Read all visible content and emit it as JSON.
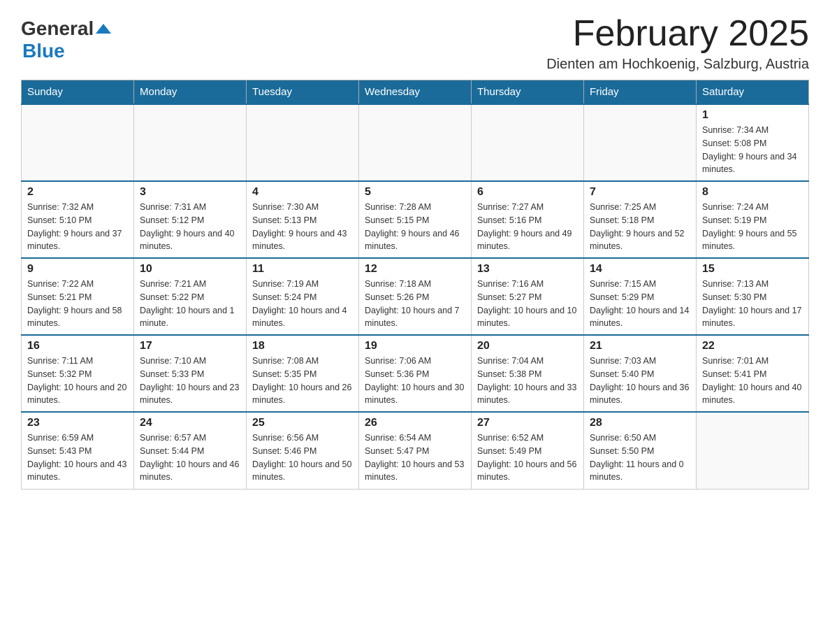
{
  "header": {
    "logo_general": "General",
    "logo_blue": "Blue",
    "month_title": "February 2025",
    "subtitle": "Dienten am Hochkoenig, Salzburg, Austria"
  },
  "weekdays": [
    "Sunday",
    "Monday",
    "Tuesday",
    "Wednesday",
    "Thursday",
    "Friday",
    "Saturday"
  ],
  "weeks": [
    [
      {
        "day": "",
        "sunrise": "",
        "sunset": "",
        "daylight": ""
      },
      {
        "day": "",
        "sunrise": "",
        "sunset": "",
        "daylight": ""
      },
      {
        "day": "",
        "sunrise": "",
        "sunset": "",
        "daylight": ""
      },
      {
        "day": "",
        "sunrise": "",
        "sunset": "",
        "daylight": ""
      },
      {
        "day": "",
        "sunrise": "",
        "sunset": "",
        "daylight": ""
      },
      {
        "day": "",
        "sunrise": "",
        "sunset": "",
        "daylight": ""
      },
      {
        "day": "1",
        "sunrise": "Sunrise: 7:34 AM",
        "sunset": "Sunset: 5:08 PM",
        "daylight": "Daylight: 9 hours and 34 minutes."
      }
    ],
    [
      {
        "day": "2",
        "sunrise": "Sunrise: 7:32 AM",
        "sunset": "Sunset: 5:10 PM",
        "daylight": "Daylight: 9 hours and 37 minutes."
      },
      {
        "day": "3",
        "sunrise": "Sunrise: 7:31 AM",
        "sunset": "Sunset: 5:12 PM",
        "daylight": "Daylight: 9 hours and 40 minutes."
      },
      {
        "day": "4",
        "sunrise": "Sunrise: 7:30 AM",
        "sunset": "Sunset: 5:13 PM",
        "daylight": "Daylight: 9 hours and 43 minutes."
      },
      {
        "day": "5",
        "sunrise": "Sunrise: 7:28 AM",
        "sunset": "Sunset: 5:15 PM",
        "daylight": "Daylight: 9 hours and 46 minutes."
      },
      {
        "day": "6",
        "sunrise": "Sunrise: 7:27 AM",
        "sunset": "Sunset: 5:16 PM",
        "daylight": "Daylight: 9 hours and 49 minutes."
      },
      {
        "day": "7",
        "sunrise": "Sunrise: 7:25 AM",
        "sunset": "Sunset: 5:18 PM",
        "daylight": "Daylight: 9 hours and 52 minutes."
      },
      {
        "day": "8",
        "sunrise": "Sunrise: 7:24 AM",
        "sunset": "Sunset: 5:19 PM",
        "daylight": "Daylight: 9 hours and 55 minutes."
      }
    ],
    [
      {
        "day": "9",
        "sunrise": "Sunrise: 7:22 AM",
        "sunset": "Sunset: 5:21 PM",
        "daylight": "Daylight: 9 hours and 58 minutes."
      },
      {
        "day": "10",
        "sunrise": "Sunrise: 7:21 AM",
        "sunset": "Sunset: 5:22 PM",
        "daylight": "Daylight: 10 hours and 1 minute."
      },
      {
        "day": "11",
        "sunrise": "Sunrise: 7:19 AM",
        "sunset": "Sunset: 5:24 PM",
        "daylight": "Daylight: 10 hours and 4 minutes."
      },
      {
        "day": "12",
        "sunrise": "Sunrise: 7:18 AM",
        "sunset": "Sunset: 5:26 PM",
        "daylight": "Daylight: 10 hours and 7 minutes."
      },
      {
        "day": "13",
        "sunrise": "Sunrise: 7:16 AM",
        "sunset": "Sunset: 5:27 PM",
        "daylight": "Daylight: 10 hours and 10 minutes."
      },
      {
        "day": "14",
        "sunrise": "Sunrise: 7:15 AM",
        "sunset": "Sunset: 5:29 PM",
        "daylight": "Daylight: 10 hours and 14 minutes."
      },
      {
        "day": "15",
        "sunrise": "Sunrise: 7:13 AM",
        "sunset": "Sunset: 5:30 PM",
        "daylight": "Daylight: 10 hours and 17 minutes."
      }
    ],
    [
      {
        "day": "16",
        "sunrise": "Sunrise: 7:11 AM",
        "sunset": "Sunset: 5:32 PM",
        "daylight": "Daylight: 10 hours and 20 minutes."
      },
      {
        "day": "17",
        "sunrise": "Sunrise: 7:10 AM",
        "sunset": "Sunset: 5:33 PM",
        "daylight": "Daylight: 10 hours and 23 minutes."
      },
      {
        "day": "18",
        "sunrise": "Sunrise: 7:08 AM",
        "sunset": "Sunset: 5:35 PM",
        "daylight": "Daylight: 10 hours and 26 minutes."
      },
      {
        "day": "19",
        "sunrise": "Sunrise: 7:06 AM",
        "sunset": "Sunset: 5:36 PM",
        "daylight": "Daylight: 10 hours and 30 minutes."
      },
      {
        "day": "20",
        "sunrise": "Sunrise: 7:04 AM",
        "sunset": "Sunset: 5:38 PM",
        "daylight": "Daylight: 10 hours and 33 minutes."
      },
      {
        "day": "21",
        "sunrise": "Sunrise: 7:03 AM",
        "sunset": "Sunset: 5:40 PM",
        "daylight": "Daylight: 10 hours and 36 minutes."
      },
      {
        "day": "22",
        "sunrise": "Sunrise: 7:01 AM",
        "sunset": "Sunset: 5:41 PM",
        "daylight": "Daylight: 10 hours and 40 minutes."
      }
    ],
    [
      {
        "day": "23",
        "sunrise": "Sunrise: 6:59 AM",
        "sunset": "Sunset: 5:43 PM",
        "daylight": "Daylight: 10 hours and 43 minutes."
      },
      {
        "day": "24",
        "sunrise": "Sunrise: 6:57 AM",
        "sunset": "Sunset: 5:44 PM",
        "daylight": "Daylight: 10 hours and 46 minutes."
      },
      {
        "day": "25",
        "sunrise": "Sunrise: 6:56 AM",
        "sunset": "Sunset: 5:46 PM",
        "daylight": "Daylight: 10 hours and 50 minutes."
      },
      {
        "day": "26",
        "sunrise": "Sunrise: 6:54 AM",
        "sunset": "Sunset: 5:47 PM",
        "daylight": "Daylight: 10 hours and 53 minutes."
      },
      {
        "day": "27",
        "sunrise": "Sunrise: 6:52 AM",
        "sunset": "Sunset: 5:49 PM",
        "daylight": "Daylight: 10 hours and 56 minutes."
      },
      {
        "day": "28",
        "sunrise": "Sunrise: 6:50 AM",
        "sunset": "Sunset: 5:50 PM",
        "daylight": "Daylight: 11 hours and 0 minutes."
      },
      {
        "day": "",
        "sunrise": "",
        "sunset": "",
        "daylight": ""
      }
    ]
  ]
}
